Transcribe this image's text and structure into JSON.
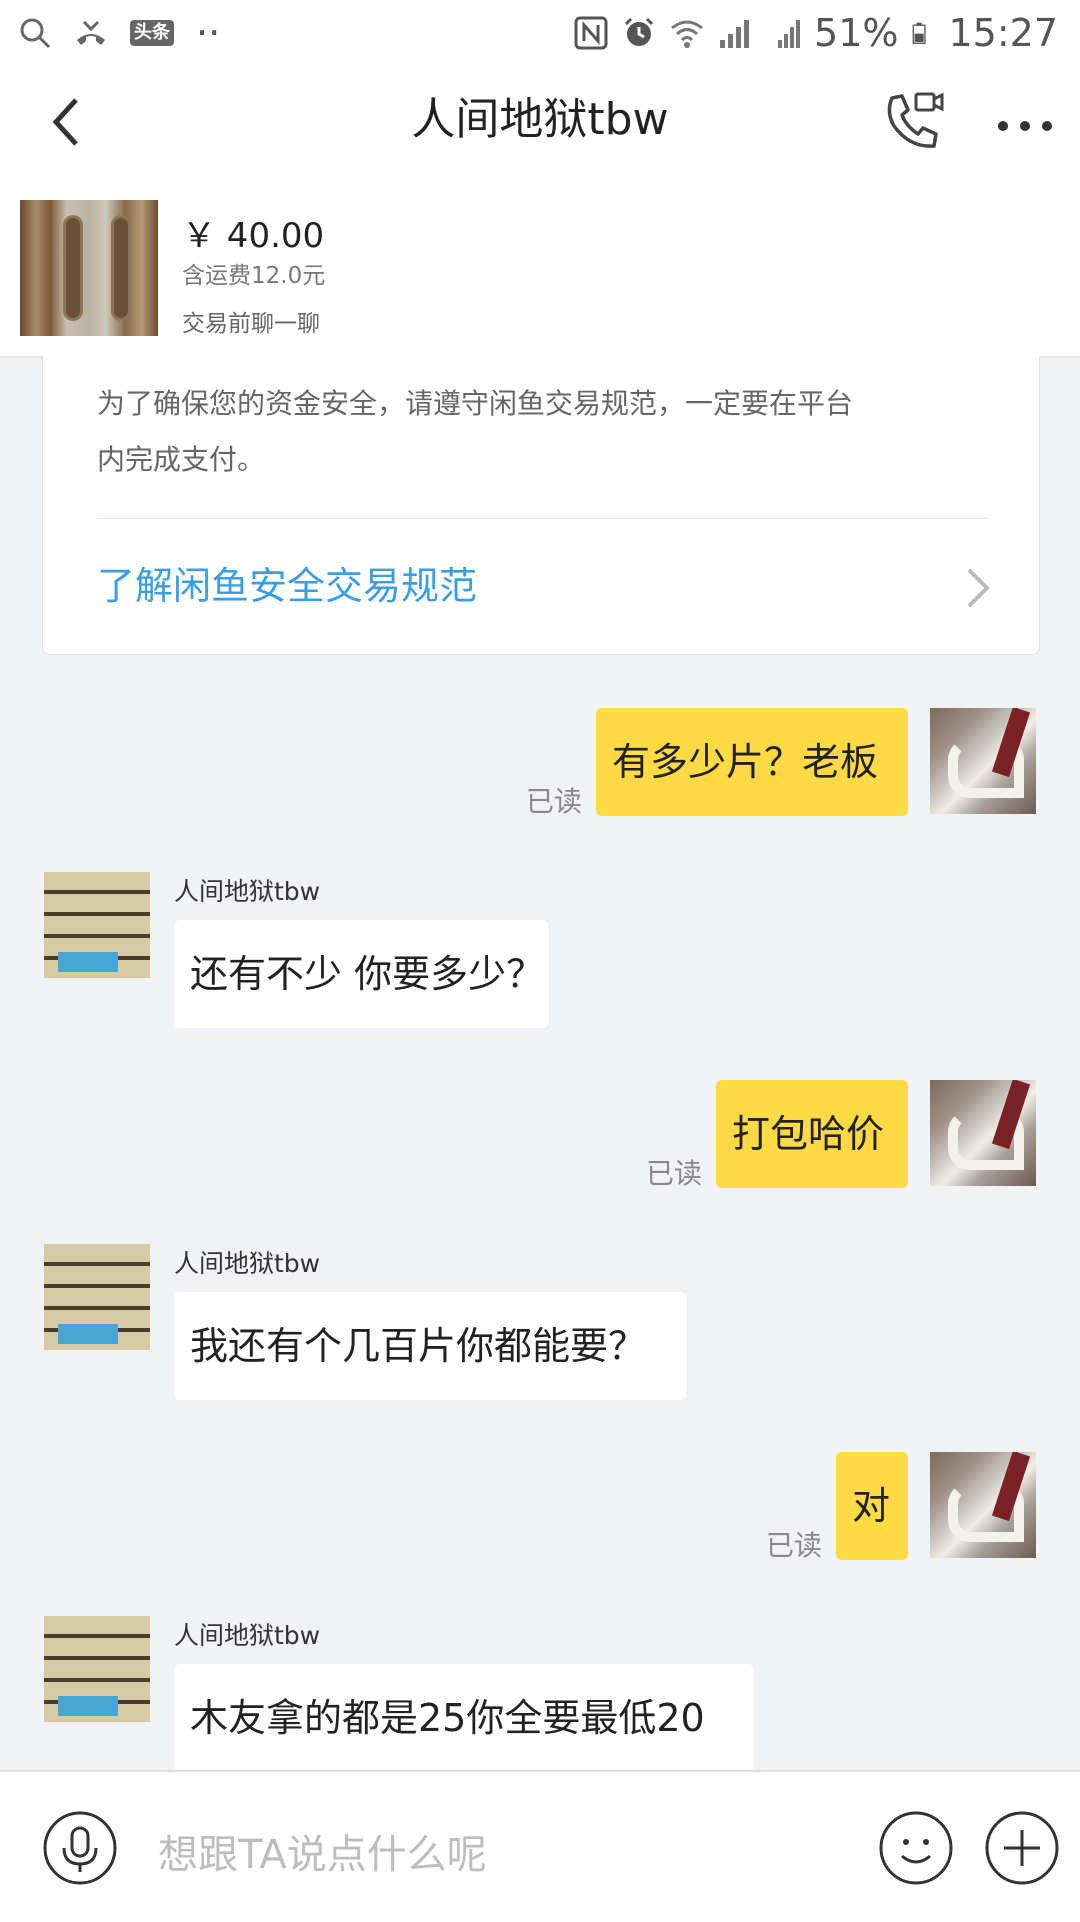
{
  "status_bar": {
    "badge": "头条",
    "dots": "··",
    "battery": "51%",
    "time": "15:27"
  },
  "header": {
    "title": "人间地狱tbw"
  },
  "product": {
    "price": "￥ 40.00",
    "shipping": "含运费12.0元",
    "prechat": "交易前聊一聊"
  },
  "notice": {
    "text": "为了确保您的资金安全，请遵守闲鱼交易规范，一定要在平台内完成支付。",
    "link": "了解闲鱼安全交易规范"
  },
  "messages": [
    {
      "from": "me",
      "text": "有多少片？老板",
      "status": "已读"
    },
    {
      "from": "them",
      "sender": "人间地狱tbw",
      "text": "还有不少 你要多少？"
    },
    {
      "from": "me",
      "text": "打包哈价",
      "status": "已读"
    },
    {
      "from": "them",
      "sender": "人间地狱tbw",
      "text": "我还有个几百片你都能要？"
    },
    {
      "from": "me",
      "text": "对",
      "status": "已读"
    },
    {
      "from": "them",
      "sender": "人间地狱tbw",
      "text": "木友拿的都是25你全要最低20"
    }
  ],
  "input": {
    "placeholder": "想跟TA说点什么呢"
  }
}
